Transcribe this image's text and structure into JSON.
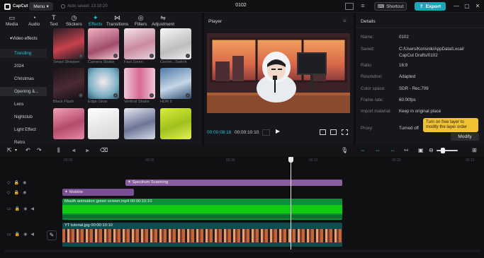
{
  "app": {
    "name": "CapCut",
    "menu_label": "Menu",
    "autosave": "Auto saved: 13:18:20",
    "project_title": "0102"
  },
  "header": {
    "shortcut_label": "Shortcut",
    "export_label": "Export"
  },
  "tabs": [
    {
      "label": "Media",
      "icon": "media-icon"
    },
    {
      "label": "Audio",
      "icon": "audio-icon"
    },
    {
      "label": "Text",
      "icon": "text-icon"
    },
    {
      "label": "Stickers",
      "icon": "stickers-icon"
    },
    {
      "label": "Effects",
      "icon": "effects-icon",
      "active": true
    },
    {
      "label": "Transitions",
      "icon": "transitions-icon"
    },
    {
      "label": "Filters",
      "icon": "filters-icon"
    },
    {
      "label": "Adjustment",
      "icon": "adjustment-icon"
    }
  ],
  "categories": [
    {
      "label": "Video effects",
      "type": "head"
    },
    {
      "label": "Trending",
      "type": "sel"
    },
    {
      "label": "2024"
    },
    {
      "label": "Christmas"
    },
    {
      "label": "Opening &...",
      "type": "hl"
    },
    {
      "label": "Lens"
    },
    {
      "label": "Nightclub"
    },
    {
      "label": "Light Effect"
    },
    {
      "label": "Retro"
    }
  ],
  "effects": [
    {
      "label": "Smart Sharpen"
    },
    {
      "label": "Camera Shake"
    },
    {
      "label": "Fast Zoom"
    },
    {
      "label": "Center...Switch"
    },
    {
      "label": "Black Flash"
    },
    {
      "label": "Edge Glow"
    },
    {
      "label": "Vertical Shake"
    },
    {
      "label": "HDR II"
    },
    {
      "label": ""
    },
    {
      "label": ""
    },
    {
      "label": ""
    },
    {
      "label": ""
    }
  ],
  "player": {
    "title": "Player",
    "current_time": "00:00:08:18",
    "total_time": "00:00:10:10"
  },
  "details": {
    "title": "Details",
    "rows": [
      {
        "key": "Name:",
        "value": "0102"
      },
      {
        "key": "Saved:",
        "value": "C:/Users/Korisnik/AppData/Local/"
      },
      {
        "key": "",
        "value": "CapCut Drafts/0102"
      },
      {
        "key": "Ratio:",
        "value": "16:9"
      },
      {
        "key": "Resolution:",
        "value": "Adapted"
      },
      {
        "key": "Color space:",
        "value": "SDR - Rec.709"
      },
      {
        "key": "Frame rate:",
        "value": "60.00fps"
      },
      {
        "key": "Import material:",
        "value": "Keep in original place"
      },
      {
        "key": "Proxy:",
        "value": "Turned off"
      }
    ],
    "tooltip": "Turn on free layer to modify the layer order",
    "modify_label": "Modify"
  },
  "timeline": {
    "ticks": [
      "00:00",
      "00:05",
      "00:00",
      "00:15",
      "00:20",
      "00:12"
    ],
    "clips": {
      "spectrum": "Spectrum Scanning",
      "wobble": "Wobble",
      "mouth": "Mouth animation green screen.mp4  00:00:10:10",
      "yt": "YT tutorial.jpg  00:00:10:10"
    },
    "cover_label": "Cover"
  }
}
